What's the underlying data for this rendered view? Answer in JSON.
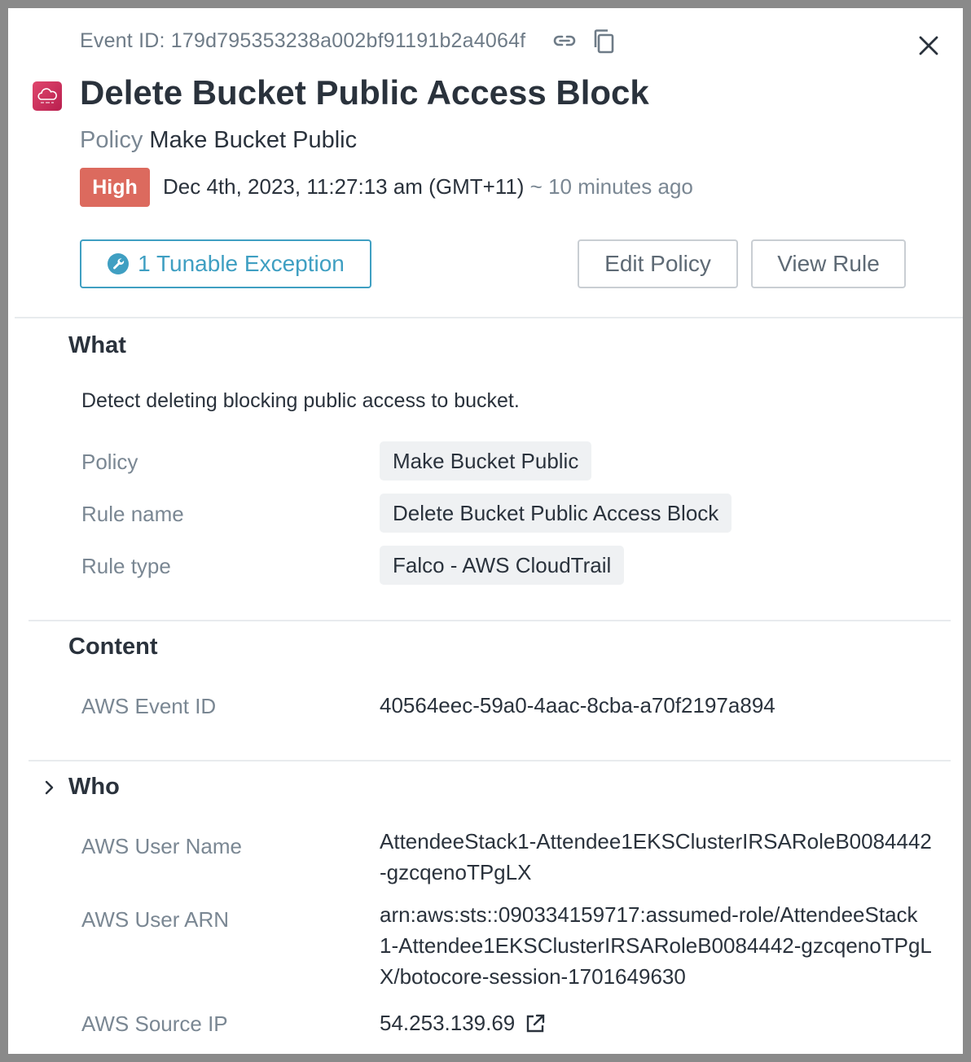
{
  "header": {
    "event_id": "Event ID: 179d795353238a002bf91191b2a4064f",
    "title": "Delete Bucket Public Access Block",
    "policy_label": "Policy",
    "policy_value": "Make Bucket Public",
    "severity": "High",
    "timestamp": "Dec 4th, 2023, 11:27:13 am (GMT+11)",
    "relative_time": "~ 10 minutes ago"
  },
  "actions": {
    "tunable_exception": "1 Tunable Exception",
    "edit_policy": "Edit Policy",
    "view_rule": "View Rule"
  },
  "what": {
    "heading": "What",
    "description": "Detect deleting blocking public access to bucket.",
    "rows": [
      {
        "label": "Policy",
        "value": "Make Bucket Public"
      },
      {
        "label": "Rule name",
        "value": "Delete Bucket Public Access Block"
      },
      {
        "label": "Rule type",
        "value": "Falco - AWS CloudTrail"
      }
    ]
  },
  "content": {
    "heading": "Content",
    "rows": [
      {
        "label": "AWS Event ID",
        "value": "40564eec-59a0-4aac-8cba-a70f2197a894"
      }
    ]
  },
  "who": {
    "heading": "Who",
    "rows": [
      {
        "label": "AWS User Name",
        "lines": [
          "AttendeeStack1-Attendee1EKSClusterIRSARoleB0084442",
          "-gzcqenoTPgLX"
        ]
      },
      {
        "label": "AWS User ARN",
        "lines": [
          "arn:aws:sts::090334159717:assumed-role/AttendeeStack",
          "1-Attendee1EKSClusterIRSARoleB0084442-gzcqenoTPgL",
          "X/botocore-session-1701649630"
        ]
      },
      {
        "label": "AWS Source IP",
        "value": "54.253.139.69"
      }
    ]
  },
  "colors": {
    "severity_high": "#dc6a5e",
    "accent": "#3f9fc2",
    "logo": "#d63a63"
  },
  "icons": [
    "link-icon",
    "copy-icon",
    "close-icon",
    "cloud-logo-icon",
    "wrench-icon",
    "chevron-right-icon",
    "external-link-icon"
  ]
}
